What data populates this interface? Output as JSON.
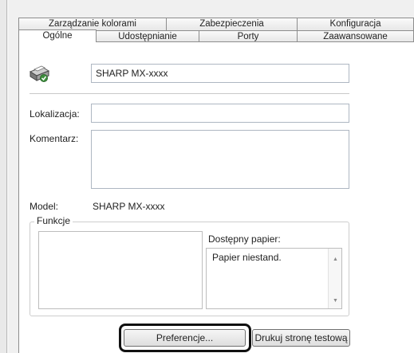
{
  "tabs_row1": [
    "Zarządzanie kolorami",
    "Zabezpieczenia",
    "Konfiguracja"
  ],
  "tabs_row2": [
    "Ogólne",
    "Udostępnianie",
    "Porty",
    "Zaawansowane"
  ],
  "printer_name": "SHARP MX-xxxx",
  "location": {
    "label": "Lokalizacja:",
    "value": ""
  },
  "comment": {
    "label": "Komentarz:",
    "value": ""
  },
  "model": {
    "label": "Model:",
    "value": "SHARP MX-xxxx"
  },
  "features": {
    "title": "Funkcje",
    "paper_label": "Dostępny papier:",
    "paper_items": [
      "Papier niestand."
    ]
  },
  "buttons": {
    "preferences": "Preferencje...",
    "test_page": "Drukuj stronę testową"
  },
  "icons": {
    "printer": "printer-icon",
    "scroll_up": "scroll-up-arrow-icon",
    "scroll_down": "scroll-down-arrow-icon"
  },
  "colors": {
    "highlight": "#111111",
    "field_border": "#aeb7c2"
  }
}
